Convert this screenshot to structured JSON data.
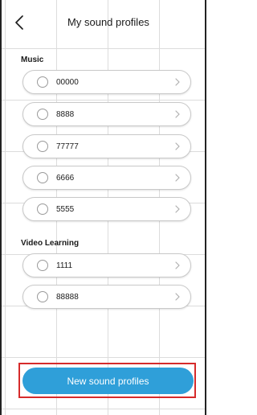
{
  "header": {
    "title": "My sound profiles",
    "back_icon": "chevron-left-icon"
  },
  "sections": [
    {
      "label": "Music",
      "items": [
        {
          "label": "00000",
          "selected": false
        },
        {
          "label": "8888",
          "selected": false
        },
        {
          "label": "77777",
          "selected": false
        },
        {
          "label": "6666",
          "selected": false
        },
        {
          "label": "5555",
          "selected": false
        }
      ]
    },
    {
      "label": "Video Learning",
      "items": [
        {
          "label": "1111",
          "selected": false
        },
        {
          "label": "88888",
          "selected": false
        }
      ]
    }
  ],
  "footer": {
    "new_button_label": "New sound profiles"
  },
  "colors": {
    "accent": "#2f9fd9",
    "highlight": "#d62b2b",
    "text": "#1a1a1a"
  }
}
